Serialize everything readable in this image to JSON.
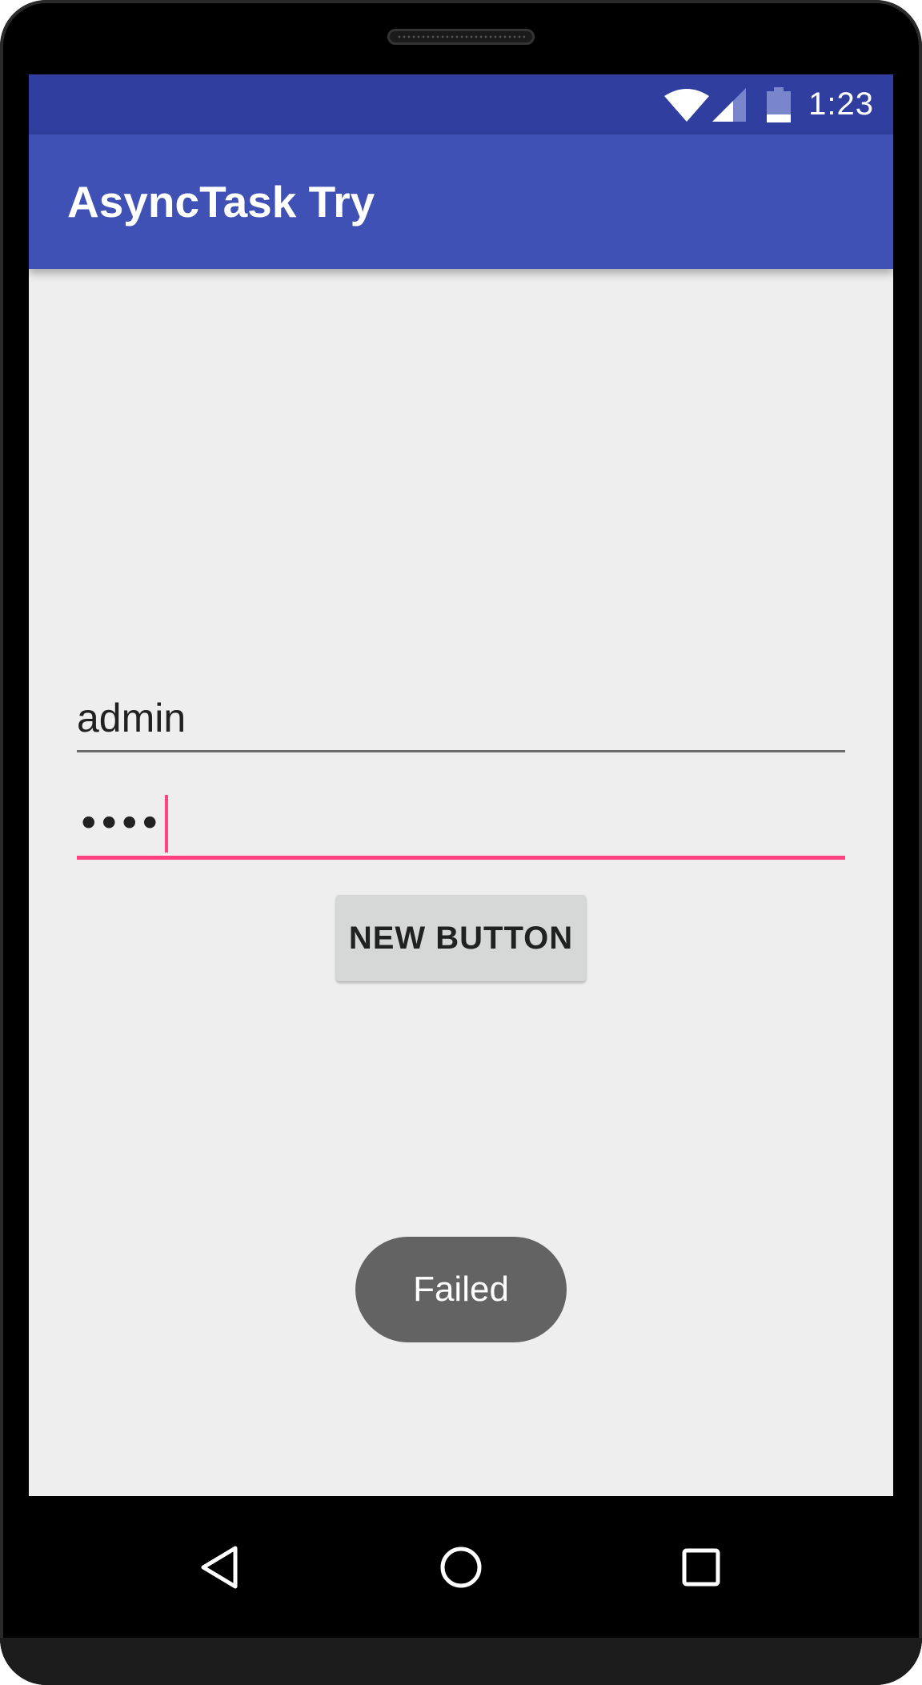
{
  "status_bar": {
    "time": "1:23",
    "icons": [
      "wifi-icon",
      "cell-signal-icon",
      "battery-icon"
    ]
  },
  "app_bar": {
    "title": "AsyncTask Try"
  },
  "form": {
    "username_value": "admin",
    "password_value": "••••"
  },
  "button": {
    "label": "NEW BUTTON"
  },
  "toast": {
    "message": "Failed"
  },
  "nav_bar": {
    "icons": [
      "back-icon",
      "home-icon",
      "recents-icon"
    ]
  },
  "colors": {
    "status_bar": "#303f9f",
    "app_bar": "#3f51b5",
    "accent": "#ff4081",
    "background": "#eeeeee",
    "button": "#d6d7d7",
    "toast": "#636363"
  }
}
